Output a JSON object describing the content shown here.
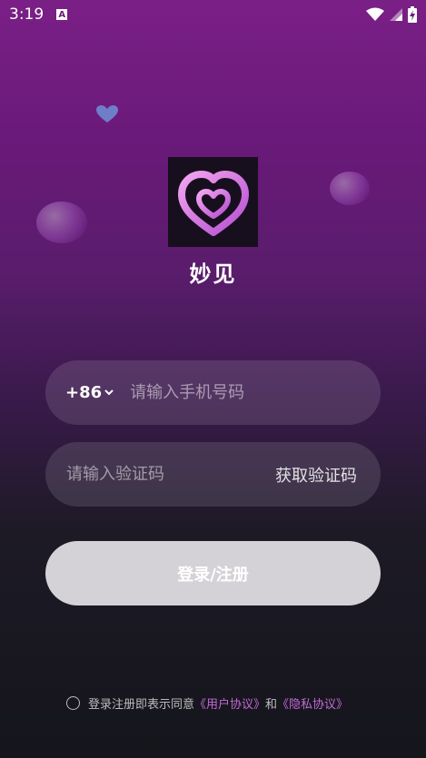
{
  "status_bar": {
    "time": "3:19",
    "notification_badge": "A"
  },
  "app": {
    "name": "妙见"
  },
  "phone": {
    "country_code": "+86",
    "placeholder": "请输入手机号码"
  },
  "verification": {
    "placeholder": "请输入验证码",
    "get_code_label": "获取验证码"
  },
  "login_button_label": "登录/注册",
  "agreement": {
    "prefix": "登录注册即表示同意",
    "user_agreement": "《用户协议》",
    "and": "和",
    "privacy_agreement": "《隐私协议》"
  },
  "colors": {
    "accent_pink": "#c26ad6",
    "button_gray": "#d4d2d6"
  }
}
